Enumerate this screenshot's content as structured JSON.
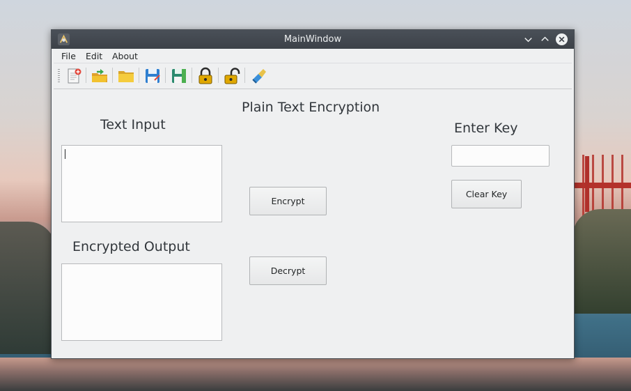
{
  "window": {
    "title": "MainWindow"
  },
  "menubar": {
    "items": [
      "File",
      "Edit",
      "About"
    ]
  },
  "toolbar": {
    "tools": [
      {
        "name": "new-file-icon"
      },
      {
        "name": "open-file-icon"
      },
      {
        "name": "open-folder-icon"
      },
      {
        "name": "save-icon"
      },
      {
        "name": "save-as-icon"
      },
      {
        "name": "lock-icon"
      },
      {
        "name": "unlock-icon"
      },
      {
        "name": "clear-brush-icon"
      }
    ]
  },
  "main": {
    "heading": "Plain Text Encryption",
    "text_input_label": "Text Input",
    "text_input_value": "",
    "encrypted_output_label": "Encrypted Output",
    "encrypted_output_value": "",
    "encrypt_button": "Encrypt",
    "decrypt_button": "Decrypt",
    "enter_key_label": "Enter Key",
    "key_value": "",
    "clear_key_button": "Clear Key"
  },
  "colors": {
    "titlebar": "#3c4148",
    "window_bg": "#eff0f1",
    "lock_gold": "#e0a800",
    "folder_yellow": "#f2c230",
    "save_blue": "#2f7fd0",
    "close_circle": "#eef0f1"
  }
}
